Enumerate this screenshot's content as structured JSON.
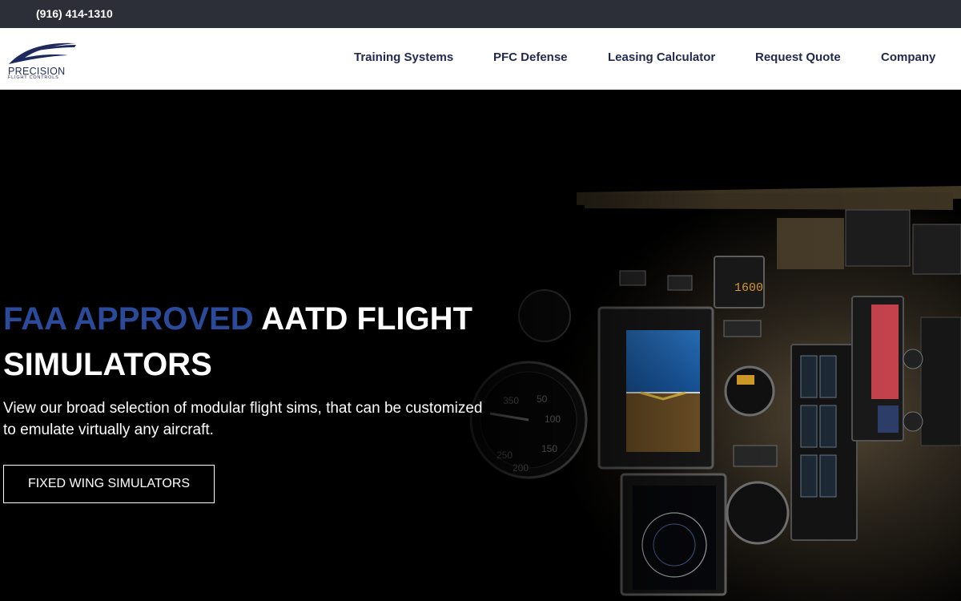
{
  "topbar": {
    "phone": "(916) 414-1310"
  },
  "logo": {
    "name": "PRECISION",
    "tagline": "FLIGHT CONTROLS"
  },
  "nav": {
    "items": [
      {
        "label": "Training Systems"
      },
      {
        "label": "PFC Defense"
      },
      {
        "label": "Leasing Calculator"
      },
      {
        "label": "Request Quote"
      },
      {
        "label": "Company"
      }
    ]
  },
  "hero": {
    "headline_accent": "FAA APPROVED",
    "headline_rest": "AATD FLIGHT SIMULATORS",
    "subtext": "View our broad selection of modular flight sims, that can be customized to emulate virtually any aircraft.",
    "cta_label": "FIXED WING SIMULATORS",
    "attitude_display_value": "1600"
  },
  "colors": {
    "topbar_bg": "#2c2e38",
    "nav_text": "#232a4e",
    "accent_blue": "#2c4a9a",
    "hero_bg": "#000000"
  }
}
